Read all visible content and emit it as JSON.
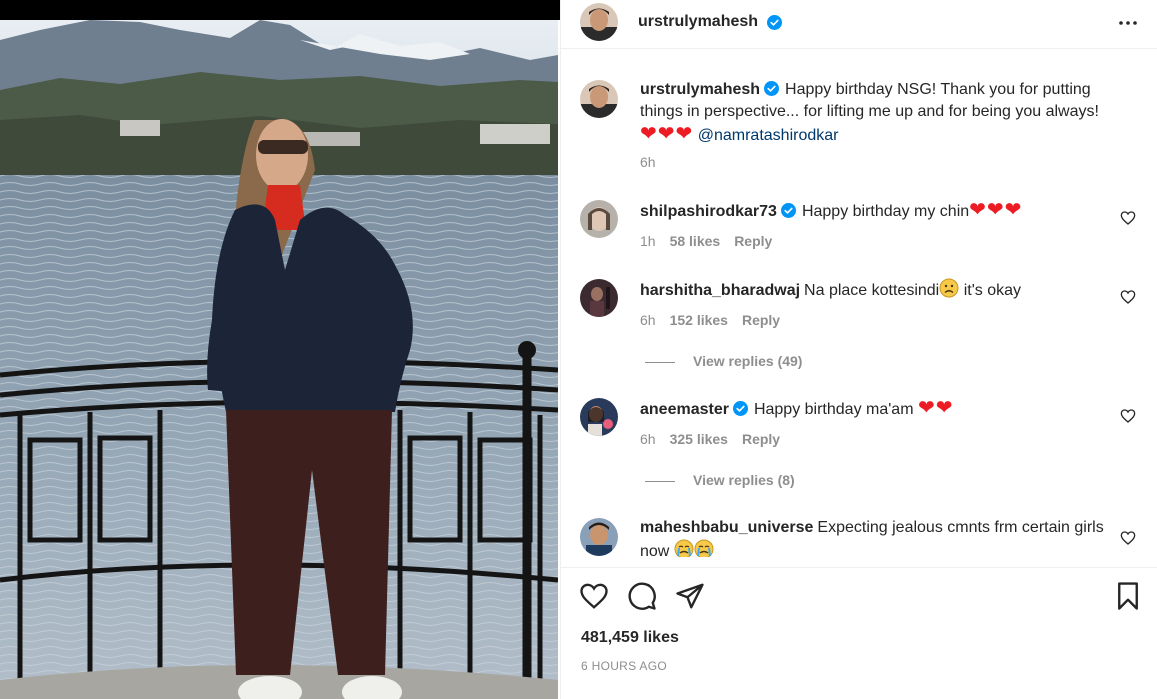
{
  "post": {
    "author": "urstrulymahesh",
    "caption_text": "Happy birthday NSG! Thank you for putting things in perspective... for lifting me up and for being you always!",
    "caption_hearts": "❤❤❤",
    "mention": "@namratashirodkar",
    "caption_time": "6h",
    "likes": "481,459 likes",
    "posted_ago": "6 HOURS AGO"
  },
  "comments": [
    {
      "username": "shilpashirodkar73",
      "verified": true,
      "text": "Happy birthday my chin",
      "emoji": "❤❤❤",
      "time": "1h",
      "likes": "58 likes",
      "reply": "Reply"
    },
    {
      "username": "harshitha_bharadwaj",
      "verified": false,
      "text": "Na place kottesindi",
      "emoji_after": "it's okay",
      "time": "6h",
      "likes": "152 likes",
      "reply": "Reply",
      "view_replies": "View replies (49)"
    },
    {
      "username": "aneemaster",
      "verified": true,
      "text": "Happy birthday ma'am",
      "emoji": "❤❤",
      "time": "6h",
      "likes": "325 likes",
      "reply": "Reply",
      "view_replies": "View replies (8)"
    },
    {
      "username": "maheshbabu_universe",
      "verified": false,
      "text": "Expecting jealous cmnts frm certain girls now"
    }
  ],
  "icons": {
    "verified": "verified-badge-icon",
    "more": "more-options-icon",
    "like": "heart-icon",
    "comment": "comment-bubble-icon",
    "share": "paper-plane-icon",
    "save": "bookmark-icon"
  },
  "colors": {
    "verified": "#0095f6",
    "heart": "#ed1c24",
    "muted": "#8e8e8e",
    "mention": "#00376b"
  }
}
